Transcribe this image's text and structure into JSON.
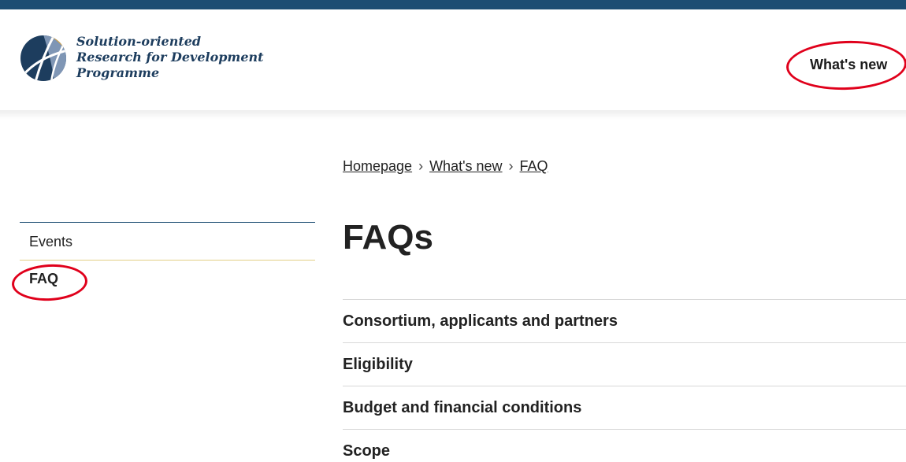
{
  "header": {
    "logo_lines": [
      "Solution-oriented",
      "Research for Development",
      "Programme"
    ],
    "nav_whats_new": "What's new",
    "colors": {
      "top_bar": "#1d4d73",
      "logo_navy": "#1d3d5e",
      "logo_gold": "#d9a441",
      "highlight": "#e0001b"
    }
  },
  "breadcrumb": {
    "items": [
      "Homepage",
      "What's new",
      "FAQ"
    ],
    "separator": "›"
  },
  "sidenav": {
    "items": [
      {
        "label": "Events",
        "active": false
      },
      {
        "label": "FAQ",
        "active": true
      }
    ]
  },
  "main": {
    "title": "FAQs",
    "faq_categories": [
      "Consortium, applicants and partners",
      "Eligibility",
      "Budget and financial conditions",
      "Scope"
    ]
  }
}
